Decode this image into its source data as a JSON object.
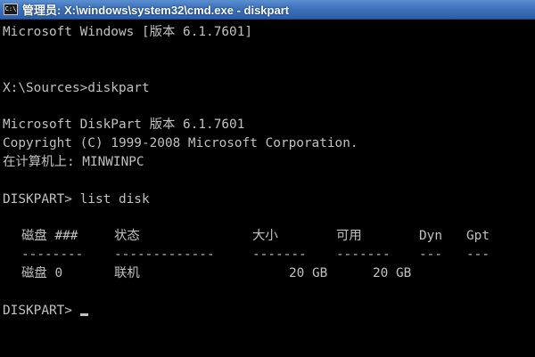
{
  "window": {
    "title": "管理员: X:\\windows\\system32\\cmd.exe - diskpart",
    "icon_label": "C:\\"
  },
  "console": {
    "line_1": "Microsoft Windows [版本 6.1.7601]",
    "line_2": "X:\\Sources>diskpart",
    "line_3": "Microsoft DiskPart 版本 6.1.7601",
    "line_4": "Copyright (C) 1999-2008 Microsoft Corporation.",
    "line_5": "在计算机上: MINWINPC",
    "line_6": "DISKPART> list disk",
    "prompt": "DISKPART> ",
    "table": {
      "headers": [
        "磁盘 ###",
        "状态",
        "大小",
        "可用",
        "Dyn",
        "Gpt"
      ],
      "separators": [
        "--------",
        "-------------",
        "-------",
        "-------",
        "---",
        "---"
      ],
      "rows": [
        [
          "磁盘 0",
          "联机",
          "20 GB",
          "20 GB",
          "",
          ""
        ]
      ]
    }
  },
  "colors": {
    "console_text": "#c0c0c0",
    "console_background": "#000000",
    "titlebar": "#3d72bd"
  }
}
